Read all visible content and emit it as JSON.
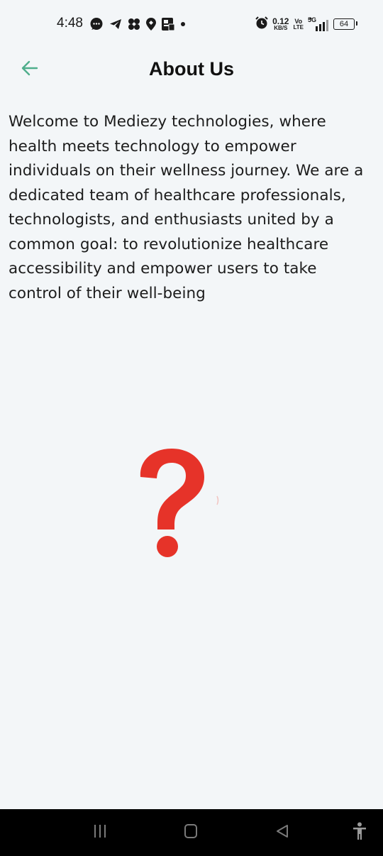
{
  "status_bar": {
    "time": "4:48",
    "net_speed_value": "0.12",
    "net_speed_unit": "KB/S",
    "volte_top": "Vo",
    "volte_bottom": "LTE",
    "network_type": "5G",
    "battery_level": "64",
    "left_icons": [
      "chat-bubble-icon",
      "telegram-icon",
      "fan-icon",
      "location-pin-icon",
      "contact-card-icon",
      "dot-icon"
    ],
    "right_icons": [
      "alarm-icon",
      "signal-icon",
      "battery-icon"
    ]
  },
  "app_bar": {
    "title": "About Us",
    "back_icon": "arrow-left-icon",
    "accent_color": "#4fae8c"
  },
  "content": {
    "about_text": "Welcome to Mediezy technologies, where health meets technology to empower individuals on their wellness journey. We are a dedicated team of healthcare professionals, technologists, and enthusiasts united by a common goal: to revolutionize healthcare accessibility and empower users to take control of their well-being",
    "illustration": "question-mark-icon",
    "illustration_color": "#e63329"
  },
  "nav_bar": {
    "buttons": [
      "recents-icon",
      "home-icon",
      "back-triangle-icon",
      "accessibility-icon"
    ]
  }
}
